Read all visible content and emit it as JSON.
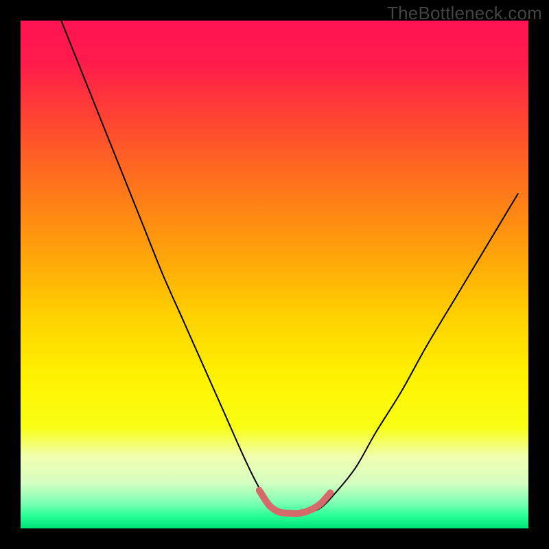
{
  "watermark": "TheBottleneck.com",
  "frame": {
    "outer_size": 800,
    "border": 30,
    "plot_size": 740,
    "border_color": "#000000"
  },
  "gradient": {
    "stops": [
      {
        "offset": 0.0,
        "color": "#ff1453"
      },
      {
        "offset": 0.08,
        "color": "#ff1b4c"
      },
      {
        "offset": 0.18,
        "color": "#ff3f35"
      },
      {
        "offset": 0.3,
        "color": "#ff6b1f"
      },
      {
        "offset": 0.45,
        "color": "#ffa00b"
      },
      {
        "offset": 0.58,
        "color": "#ffd000"
      },
      {
        "offset": 0.7,
        "color": "#fff200"
      },
      {
        "offset": 0.8,
        "color": "#f9ff14"
      },
      {
        "offset": 0.86,
        "color": "#efffb2"
      },
      {
        "offset": 0.91,
        "color": "#d6ffc0"
      },
      {
        "offset": 0.95,
        "color": "#7dffb4"
      },
      {
        "offset": 0.975,
        "color": "#29ff96"
      },
      {
        "offset": 1.0,
        "color": "#00e37a"
      }
    ]
  },
  "chart_data": {
    "type": "line",
    "title": "",
    "xlabel": "",
    "ylabel": "",
    "xlim": [
      0,
      100
    ],
    "ylim": [
      0,
      100
    ],
    "series": [
      {
        "name": "bottleneck-curve",
        "color": "#000000",
        "width": 2,
        "x": [
          8,
          12,
          16,
          20,
          24,
          28,
          32,
          36,
          40,
          44,
          47,
          50,
          53,
          56,
          59,
          62,
          66,
          70,
          75,
          80,
          86,
          92,
          98
        ],
        "y": [
          100,
          90,
          80,
          70,
          60,
          50,
          41,
          32,
          23,
          14,
          8,
          4,
          3,
          3,
          4,
          7,
          12,
          19,
          27,
          36,
          46,
          56,
          66
        ]
      },
      {
        "name": "optimal-band",
        "color": "#d46a6a",
        "width": 10,
        "linecap": "round",
        "x": [
          47,
          49,
          51,
          53,
          55,
          57,
          59,
          61
        ],
        "y": [
          7.5,
          4.5,
          3.2,
          3.0,
          3.0,
          3.6,
          4.8,
          7.0
        ]
      }
    ],
    "background": "vertical-gradient"
  }
}
